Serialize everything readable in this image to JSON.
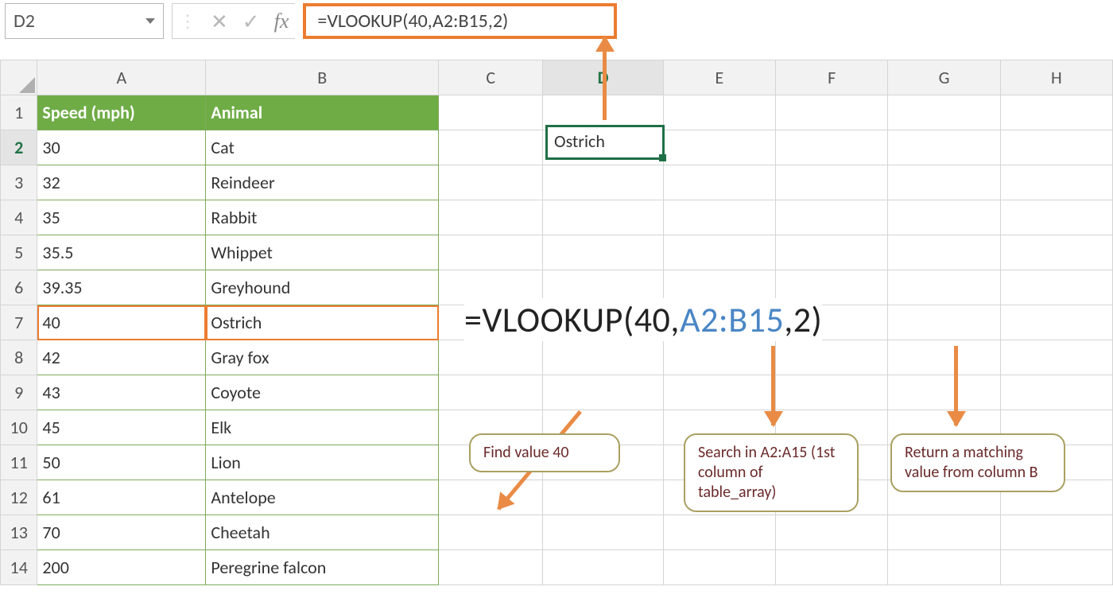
{
  "namebox": {
    "value": "D2"
  },
  "formula_bar": {
    "formula": "=VLOOKUP(40,A2:B15,2)"
  },
  "columns": [
    "A",
    "B",
    "C",
    "D",
    "E",
    "F",
    "G",
    "H"
  ],
  "rows": [
    "1",
    "2",
    "3",
    "4",
    "5",
    "6",
    "7",
    "8",
    "9",
    "10",
    "11",
    "12",
    "13",
    "14"
  ],
  "active": {
    "col": "D",
    "row": "2",
    "value": "Ostrich"
  },
  "table": {
    "headers": {
      "A": "Speed (mph)",
      "B": "Animal"
    },
    "rows": [
      {
        "speed": "30",
        "animal": "Cat"
      },
      {
        "speed": "32",
        "animal": "Reindeer"
      },
      {
        "speed": "35",
        "animal": "Rabbit"
      },
      {
        "speed": "35.5",
        "animal": "Whippet"
      },
      {
        "speed": "39.35",
        "animal": "Greyhound"
      },
      {
        "speed": "40",
        "animal": "Ostrich"
      },
      {
        "speed": "42",
        "animal": "Gray fox"
      },
      {
        "speed": "43",
        "animal": "Coyote"
      },
      {
        "speed": "45",
        "animal": "Elk"
      },
      {
        "speed": "50",
        "animal": "Lion"
      },
      {
        "speed": "61",
        "animal": "Antelope"
      },
      {
        "speed": "70",
        "animal": "Cheetah"
      },
      {
        "speed": "200",
        "animal": "Peregrine falcon"
      }
    ]
  },
  "big_formula": {
    "prefix": "=VLOOKUP(",
    "arg1": "40",
    "comma1": ",",
    "arg2": "A2:B15",
    "comma2": ",",
    "arg3": "2",
    "suffix": ")"
  },
  "callouts": {
    "c1": "Find value 40",
    "c2": "Search in A2:A15 (1st column of table_array)",
    "c3": "Return a matching value from column B"
  },
  "icons": {
    "cancel": "✕",
    "enter": "✓",
    "fx": "fx",
    "sep": "⋮"
  }
}
